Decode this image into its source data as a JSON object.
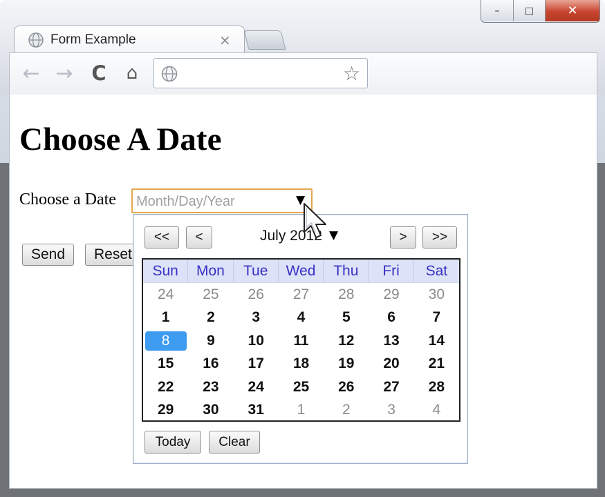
{
  "browser": {
    "tab_title": "Form Example",
    "tab_close": "×",
    "window_controls": {
      "minimize": "–",
      "maximize": "□",
      "close": "✕"
    },
    "nav": {
      "back": "←",
      "forward": "→",
      "reload": "C",
      "home": "⌂"
    },
    "address_value": "",
    "star": "☆"
  },
  "page": {
    "heading": "Choose A Date",
    "field_label": "Choose a Date",
    "date_placeholder": "Month/Day/Year",
    "dropdown_arrow": "▼",
    "send_label": "Send",
    "reset_label": "Reset"
  },
  "calendar": {
    "prev_year": "<<",
    "prev_month": "<",
    "next_month": ">",
    "next_year": ">>",
    "month_label": "July 2012",
    "month_arrow": "▼",
    "weekdays": [
      "Sun",
      "Mon",
      "Tue",
      "Wed",
      "Thu",
      "Fri",
      "Sat"
    ],
    "weeks": [
      [
        "24",
        "25",
        "26",
        "27",
        "28",
        "29",
        "30"
      ],
      [
        "1",
        "2",
        "3",
        "4",
        "5",
        "6",
        "7"
      ],
      [
        "8",
        "9",
        "10",
        "11",
        "12",
        "13",
        "14"
      ],
      [
        "15",
        "16",
        "17",
        "18",
        "19",
        "20",
        "21"
      ],
      [
        "22",
        "23",
        "24",
        "25",
        "26",
        "27",
        "28"
      ],
      [
        "29",
        "30",
        "31",
        "1",
        "2",
        "3",
        "4"
      ]
    ],
    "selected_day": "8",
    "today_label": "Today",
    "clear_label": "Clear"
  },
  "colors": {
    "accent_selected": "#3d9bf0",
    "input_focus_border": "#e3a74c",
    "weekday_text": "#3a2fc4",
    "weekday_bg": "#dce3f8"
  }
}
